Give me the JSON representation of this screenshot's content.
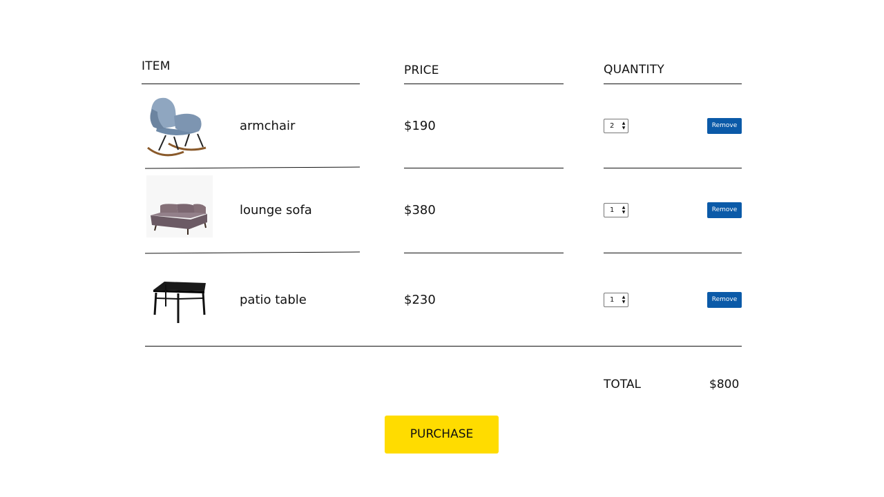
{
  "columns": {
    "item": "ITEM",
    "price": "PRICE",
    "quantity": "QUANTITY"
  },
  "rows": [
    {
      "name": "armchair",
      "price": "$190",
      "quantity": "2",
      "remove_label": "Remove",
      "thumbnail": "armchair-image"
    },
    {
      "name": "lounge sofa",
      "price": "$380",
      "quantity": "1",
      "remove_label": "Remove",
      "thumbnail": "sofa-image"
    },
    {
      "name": "patio table",
      "price": "$230",
      "quantity": "1",
      "remove_label": "Remove",
      "thumbnail": "table-image"
    }
  ],
  "total": {
    "label": "TOTAL",
    "value": "$800"
  },
  "purchase_label": "PURCHASE",
  "colors": {
    "remove_button": "#0b5aa8",
    "purchase_button": "#ffdc00"
  }
}
